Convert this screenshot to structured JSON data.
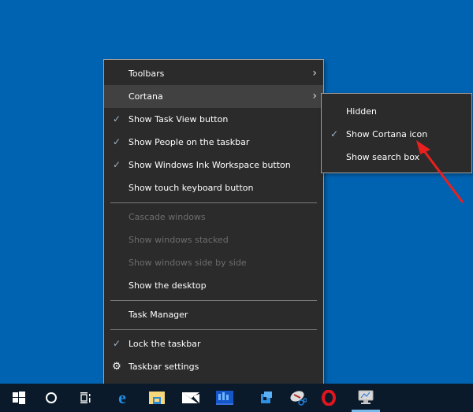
{
  "desktop": {
    "background_color": "#0063b1"
  },
  "context_menu": {
    "groups": [
      [
        {
          "label": "Toolbars",
          "checked": false,
          "submenu": true,
          "disabled": false,
          "icon": null
        },
        {
          "label": "Cortana",
          "checked": false,
          "submenu": true,
          "disabled": false,
          "highlighted": true,
          "icon": null
        },
        {
          "label": "Show Task View button",
          "checked": true,
          "disabled": false
        },
        {
          "label": "Show People on the taskbar",
          "checked": true,
          "disabled": false
        },
        {
          "label": "Show Windows Ink Workspace button",
          "checked": true,
          "disabled": false
        },
        {
          "label": "Show touch keyboard button",
          "checked": false,
          "disabled": false
        }
      ],
      [
        {
          "label": "Cascade windows",
          "checked": false,
          "disabled": true
        },
        {
          "label": "Show windows stacked",
          "checked": false,
          "disabled": true
        },
        {
          "label": "Show windows side by side",
          "checked": false,
          "disabled": true
        },
        {
          "label": "Show the desktop",
          "checked": false,
          "disabled": false
        }
      ],
      [
        {
          "label": "Task Manager",
          "checked": false,
          "disabled": false
        }
      ],
      [
        {
          "label": "Lock the taskbar",
          "checked": true,
          "disabled": false
        },
        {
          "label": "Taskbar settings",
          "checked": false,
          "disabled": false,
          "icon": "gear-icon"
        }
      ]
    ]
  },
  "cortana_submenu": {
    "items": [
      {
        "label": "Hidden",
        "checked": false
      },
      {
        "label": "Show Cortana icon",
        "checked": true
      },
      {
        "label": "Show search box",
        "checked": false
      }
    ]
  },
  "annotation": {
    "type": "arrow",
    "color": "#e8201e",
    "points_to": "Show Cortana icon"
  },
  "taskbar": {
    "background_color": "#0b1a2a",
    "items": [
      {
        "name": "start-button",
        "icon": "windows-logo-icon"
      },
      {
        "name": "cortana-button",
        "icon": "cortana-circle-icon"
      },
      {
        "name": "task-view-button",
        "icon": "task-view-icon"
      },
      {
        "name": "edge",
        "icon": "edge-icon"
      },
      {
        "name": "file-explorer",
        "icon": "folder-icon"
      },
      {
        "name": "mail",
        "icon": "mail-icon"
      },
      {
        "name": "app-blue",
        "icon": "app-chart-icon"
      },
      {
        "name": "app-cube",
        "icon": "app-cube-icon"
      },
      {
        "name": "snipping-tool",
        "icon": "snipping-tool-icon"
      },
      {
        "name": "opera",
        "icon": "opera-icon"
      },
      {
        "name": "remote-desktop",
        "icon": "monitor-icon",
        "active": true
      }
    ]
  }
}
